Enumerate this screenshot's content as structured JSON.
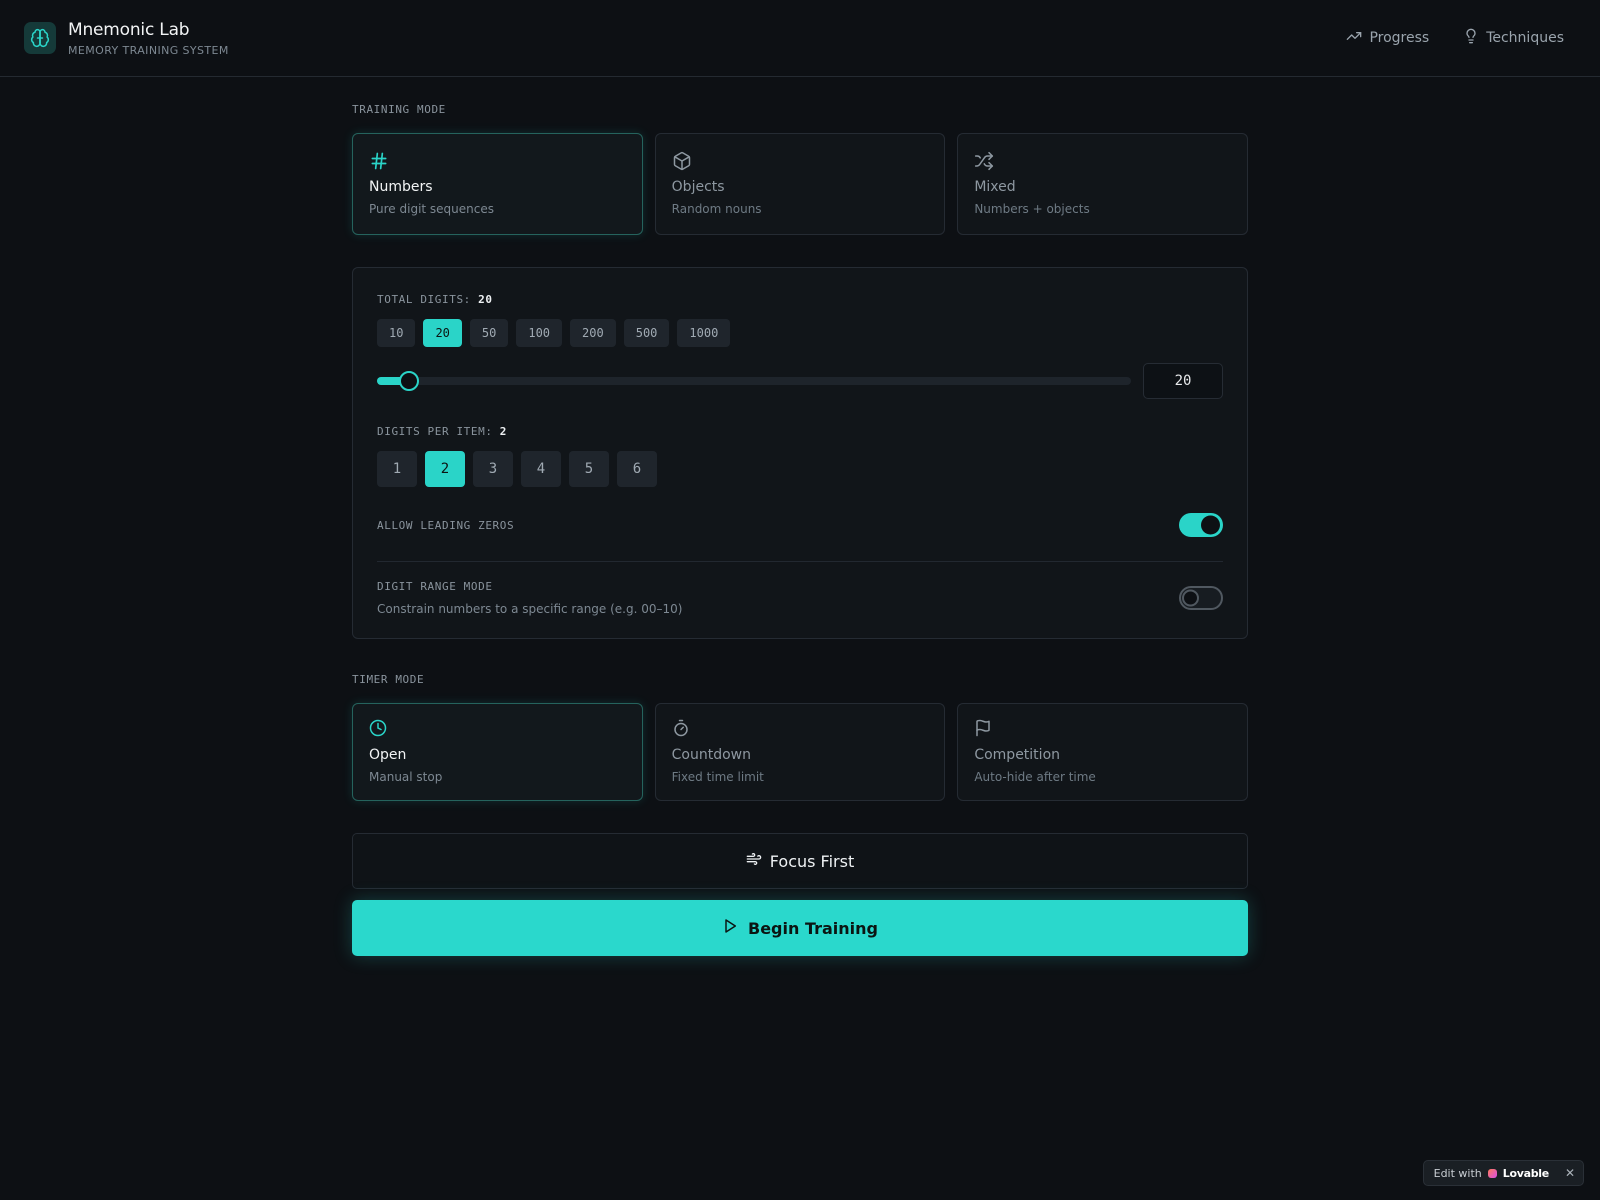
{
  "app": {
    "title": "Mnemonic Lab",
    "subtitle": "MEMORY TRAINING SYSTEM",
    "logo_icon": "brain-icon",
    "accent_color": "#2ad4c8"
  },
  "nav": {
    "items": [
      {
        "label": "Progress",
        "icon": "trending-up-icon"
      },
      {
        "label": "Techniques",
        "icon": "lightbulb-icon"
      }
    ]
  },
  "training_mode": {
    "label": "TRAINING MODE",
    "selected": "Numbers",
    "options": [
      {
        "title": "Numbers",
        "subtitle": "Pure digit sequences",
        "icon": "hash-icon"
      },
      {
        "title": "Objects",
        "subtitle": "Random nouns",
        "icon": "box-icon"
      },
      {
        "title": "Mixed",
        "subtitle": "Numbers + objects",
        "icon": "shuffle-icon"
      }
    ]
  },
  "settings": {
    "total_digits": {
      "label": "TOTAL DIGITS:",
      "value": "20",
      "presets": [
        "10",
        "20",
        "50",
        "100",
        "200",
        "500",
        "1000"
      ],
      "selected": "20",
      "slider_min": 10,
      "slider_max": 1000,
      "input_value": "20"
    },
    "digits_per_item": {
      "label": "DIGITS PER ITEM:",
      "value": "2",
      "options": [
        "1",
        "2",
        "3",
        "4",
        "5",
        "6"
      ],
      "selected": "2"
    },
    "leading_zeros": {
      "label": "ALLOW LEADING ZEROS",
      "enabled": true
    },
    "digit_range": {
      "label": "DIGIT RANGE MODE",
      "description": "Constrain numbers to a specific range (e.g. 00–10)",
      "enabled": false
    }
  },
  "timer_mode": {
    "label": "TIMER MODE",
    "selected": "Open",
    "options": [
      {
        "title": "Open",
        "subtitle": "Manual stop",
        "icon": "clock-icon"
      },
      {
        "title": "Countdown",
        "subtitle": "Fixed time limit",
        "icon": "timer-icon"
      },
      {
        "title": "Competition",
        "subtitle": "Auto-hide after time",
        "icon": "flag-icon"
      }
    ]
  },
  "actions": {
    "focus_label": "Focus First",
    "focus_icon": "wind-icon",
    "begin_label": "Begin Training",
    "begin_icon": "play-icon"
  },
  "badge": {
    "prefix": "Edit with",
    "brand": "Lovable",
    "close": "✕"
  }
}
